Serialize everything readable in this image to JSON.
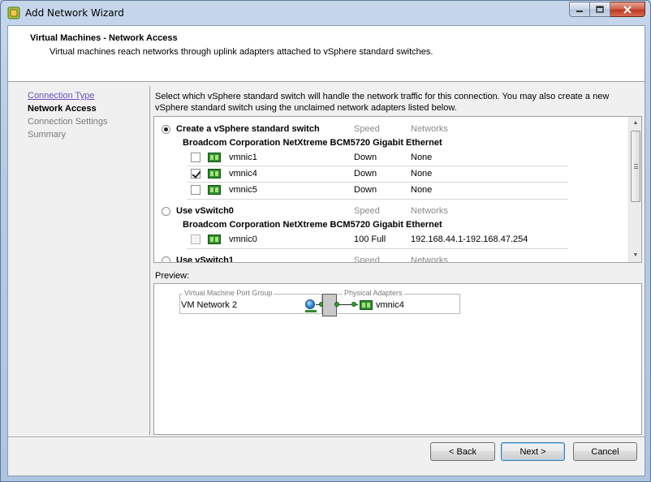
{
  "window": {
    "title": "Add Network Wizard",
    "icon": "vsphere-wizard-icon"
  },
  "header": {
    "title": "Virtual Machines - Network Access",
    "subtitle": "Virtual machines reach networks through uplink adapters attached to vSphere standard switches."
  },
  "nav": {
    "items": [
      {
        "label": "Connection Type",
        "state": "link"
      },
      {
        "label": "Network Access",
        "state": "active"
      },
      {
        "label": "Connection Settings",
        "state": "disabled"
      },
      {
        "label": "Summary",
        "state": "disabled"
      }
    ]
  },
  "instructions": "Select which vSphere standard switch will handle the network traffic for this connection. You may also create a new vSphere standard switch using the unclaimed network adapters listed below.",
  "switch_list": {
    "columns": {
      "speed": "Speed",
      "networks": "Networks"
    },
    "options": [
      {
        "label": "Create a vSphere standard switch",
        "selected": true,
        "vendor": "Broadcom Corporation NetXtreme BCM5720 Gigabit Ethernet",
        "adapters": [
          {
            "name": "vmnic1",
            "checked": false,
            "enabled": true,
            "speed": "Down",
            "networks": "None"
          },
          {
            "name": "vmnic4",
            "checked": true,
            "enabled": true,
            "speed": "Down",
            "networks": "None"
          },
          {
            "name": "vmnic5",
            "checked": false,
            "enabled": true,
            "speed": "Down",
            "networks": "None"
          }
        ]
      },
      {
        "label": "Use vSwitch0",
        "selected": false,
        "vendor": "Broadcom Corporation NetXtreme BCM5720 Gigabit Ethernet",
        "adapters": [
          {
            "name": "vmnic0",
            "checked": false,
            "enabled": false,
            "speed": "100 Full",
            "networks": "192.168.44.1-192.168.47.254"
          }
        ]
      },
      {
        "label": "Use vSwitch1",
        "selected": false
      }
    ]
  },
  "preview": {
    "label": "Preview:",
    "port_group_legend": "Virtual Machine Port Group",
    "port_group_name": "VM Network 2",
    "physical_legend": "Physical Adapters",
    "physical_adapter": "vmnic4"
  },
  "buttons": {
    "back": "< Back",
    "next": "Next >",
    "cancel": "Cancel"
  }
}
